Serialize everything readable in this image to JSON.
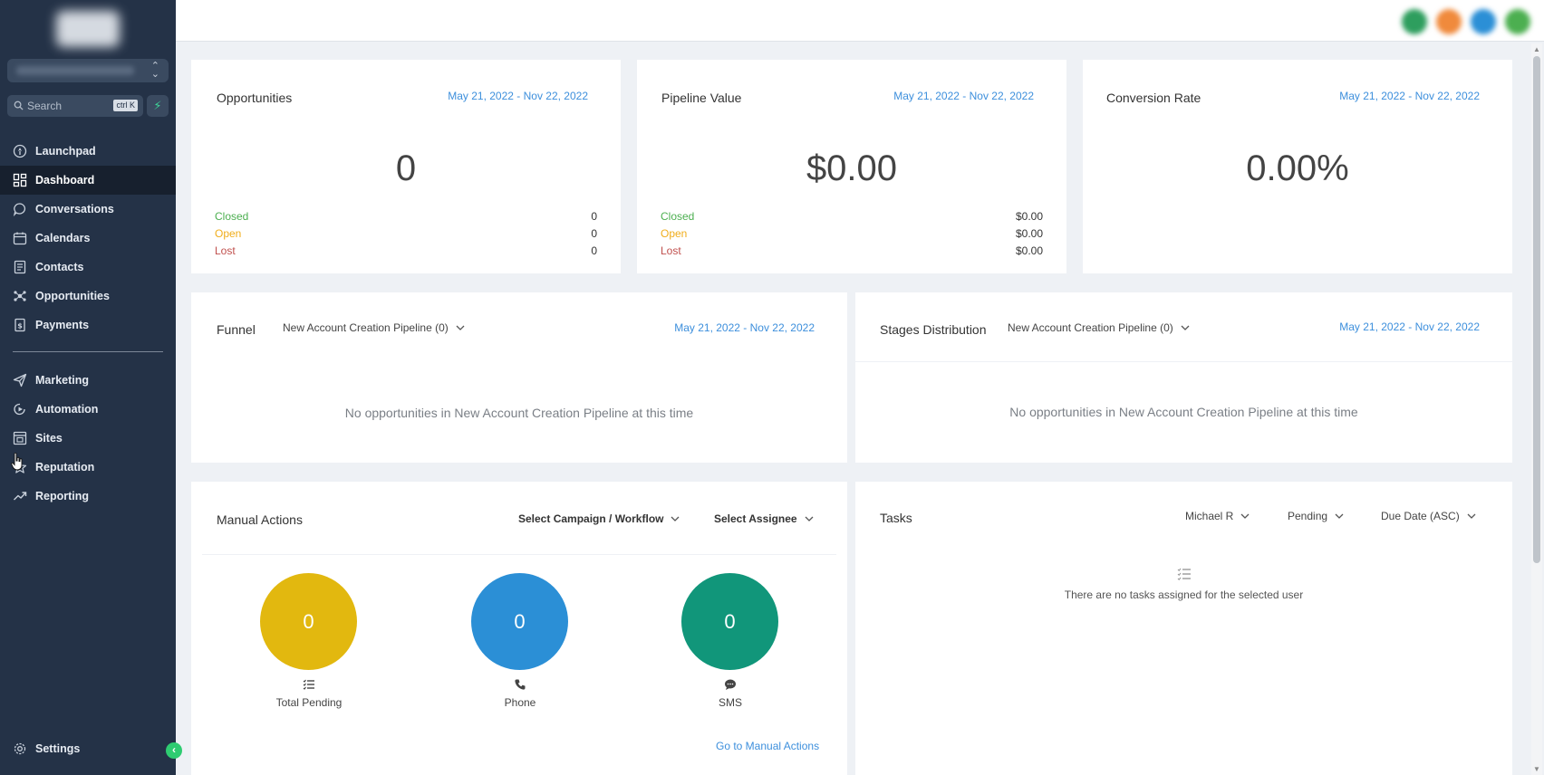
{
  "sidebar": {
    "search_placeholder": "Search",
    "search_shortcut": "ctrl K",
    "items_top": [
      {
        "label": "Launchpad",
        "icon": "rocket-icon"
      },
      {
        "label": "Dashboard",
        "icon": "grid-icon",
        "active": true
      },
      {
        "label": "Conversations",
        "icon": "chat-icon"
      },
      {
        "label": "Calendars",
        "icon": "calendar-icon"
      },
      {
        "label": "Contacts",
        "icon": "contacts-icon"
      },
      {
        "label": "Opportunities",
        "icon": "opportunities-icon"
      },
      {
        "label": "Payments",
        "icon": "payments-icon"
      }
    ],
    "items_bottom": [
      {
        "label": "Marketing",
        "icon": "send-icon"
      },
      {
        "label": "Automation",
        "icon": "automation-icon"
      },
      {
        "label": "Sites",
        "icon": "sites-icon"
      },
      {
        "label": "Reputation",
        "icon": "star-icon"
      },
      {
        "label": "Reporting",
        "icon": "trend-icon"
      }
    ],
    "settings_label": "Settings"
  },
  "cards": {
    "opportunities": {
      "title": "Opportunities",
      "date_range": "May 21, 2022 - Nov 22, 2022",
      "value": "0",
      "rows": [
        {
          "label": "Closed",
          "value": "0"
        },
        {
          "label": "Open",
          "value": "0"
        },
        {
          "label": "Lost",
          "value": "0"
        }
      ]
    },
    "pipeline_value": {
      "title": "Pipeline Value",
      "date_range": "May 21, 2022 - Nov 22, 2022",
      "value": "$0.00",
      "rows": [
        {
          "label": "Closed",
          "value": "$0.00"
        },
        {
          "label": "Open",
          "value": "$0.00"
        },
        {
          "label": "Lost",
          "value": "$0.00"
        }
      ]
    },
    "conversion_rate": {
      "title": "Conversion Rate",
      "date_range": "May 21, 2022 - Nov 22, 2022",
      "value": "0.00%"
    },
    "funnel": {
      "title": "Funnel",
      "pipeline_select": "New Account Creation Pipeline (0)",
      "date_range": "May 21, 2022 - Nov 22, 2022",
      "empty_message": "No opportunities in New Account Creation Pipeline at this time"
    },
    "stages": {
      "title": "Stages Distribution",
      "pipeline_select": "New Account Creation Pipeline (0)",
      "date_range": "May 21, 2022 - Nov 22, 2022",
      "empty_message": "No opportunities in New Account Creation Pipeline at this time"
    },
    "manual_actions": {
      "title": "Manual Actions",
      "campaign_select": "Select Campaign / Workflow",
      "assignee_select": "Select Assignee",
      "stats": [
        {
          "value": "0",
          "label": "Total Pending",
          "icon": "list-icon",
          "color": "#e2b80f"
        },
        {
          "value": "0",
          "label": "Phone",
          "icon": "phone-icon",
          "color": "#2b8fd6"
        },
        {
          "value": "0",
          "label": "SMS",
          "icon": "message-icon",
          "color": "#11967a"
        }
      ],
      "link": "Go to Manual Actions"
    },
    "tasks": {
      "title": "Tasks",
      "user_select": "Michael R",
      "status_select": "Pending",
      "sort_select": "Due Date (ASC)",
      "empty_message": "There are no tasks assigned for the selected user"
    }
  },
  "colors": {
    "sidebar_bg": "#243247",
    "accent_blue": "#3d8fdc",
    "closed": "#4caf50",
    "open": "#f0ad1b",
    "lost": "#c0504d"
  }
}
